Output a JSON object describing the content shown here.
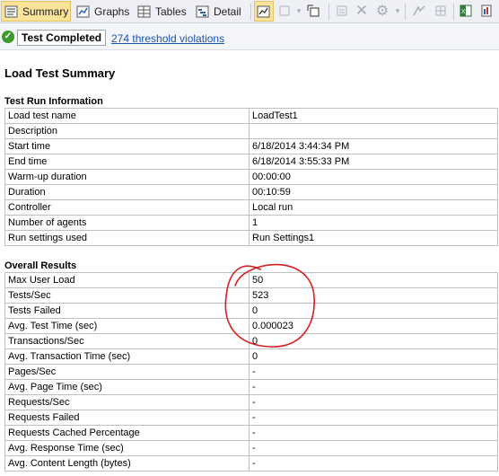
{
  "toolbar": {
    "tabs": [
      {
        "label": "Summary",
        "icon": "summary-icon",
        "active": true
      },
      {
        "label": "Graphs",
        "icon": "graphs-icon",
        "active": false
      },
      {
        "label": "Tables",
        "icon": "tables-icon",
        "active": false
      },
      {
        "label": "Detail",
        "icon": "detail-icon",
        "active": false
      }
    ]
  },
  "status": {
    "text": "Test Completed",
    "violations_link": "274 threshold violations",
    "success_color": "#3c9b2e"
  },
  "report": {
    "title": "Load Test Summary",
    "run_info": {
      "heading": "Test Run Information",
      "rows": [
        {
          "label": "Load test name",
          "value": "LoadTest1"
        },
        {
          "label": "Description",
          "value": ""
        },
        {
          "label": "Start time",
          "value": "6/18/2014 3:44:34 PM"
        },
        {
          "label": "End time",
          "value": "6/18/2014 3:55:33 PM"
        },
        {
          "label": "Warm-up duration",
          "value": "00:00:00"
        },
        {
          "label": "Duration",
          "value": "00:10:59"
        },
        {
          "label": "Controller",
          "value": "Local run"
        },
        {
          "label": "Number of agents",
          "value": "1"
        },
        {
          "label": "Run settings used",
          "value": "Run Settings1"
        }
      ]
    },
    "overall": {
      "heading": "Overall Results",
      "rows": [
        {
          "label": "Max User Load",
          "value": "50"
        },
        {
          "label": "Tests/Sec",
          "value": "523"
        },
        {
          "label": "Tests Failed",
          "value": "0"
        },
        {
          "label": "Avg. Test Time (sec)",
          "value": "0.000023"
        },
        {
          "label": "Transactions/Sec",
          "value": "0"
        },
        {
          "label": "Avg. Transaction Time (sec)",
          "value": "0"
        },
        {
          "label": "Pages/Sec",
          "value": "-"
        },
        {
          "label": "Avg. Page Time (sec)",
          "value": "-"
        },
        {
          "label": "Requests/Sec",
          "value": "-"
        },
        {
          "label": "Requests Failed",
          "value": "-"
        },
        {
          "label": "Requests Cached Percentage",
          "value": "-"
        },
        {
          "label": "Avg. Response Time (sec)",
          "value": "-"
        },
        {
          "label": "Avg. Content Length (bytes)",
          "value": "-"
        }
      ]
    },
    "annotation_color": "#d42020"
  }
}
